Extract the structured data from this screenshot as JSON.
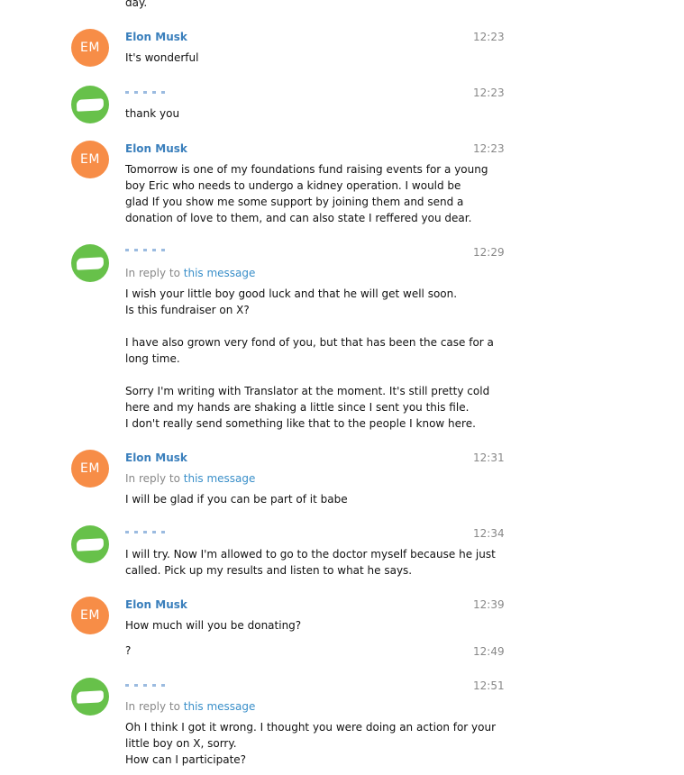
{
  "messages": [
    {
      "sender": "",
      "avatar_initials": "",
      "time": "",
      "lines": [
        "day."
      ]
    },
    {
      "sender": "Elon Musk",
      "avatar_initials": "EM",
      "time": "12:23",
      "lines": [
        "It's wonderful"
      ]
    },
    {
      "sender": "",
      "avatar_initials": "",
      "time": "12:23",
      "lines": [
        "thank you"
      ]
    },
    {
      "sender": "Elon Musk",
      "avatar_initials": "EM",
      "time": "12:23",
      "lines": [
        "Tomorrow is one of my foundations fund raising events for a young",
        "boy Eric who needs to undergo a kidney operation.  I would be",
        "glad If you show me some support by joining them and send a",
        "donation of love to them, and can also state I reffered you dear."
      ]
    },
    {
      "sender": "",
      "avatar_initials": "",
      "time": "12:29",
      "reply_prefix": "In reply to",
      "reply_link": "this message",
      "lines": [
        "I wish your little boy good luck and that he will get well soon.",
        "Is this fundraiser on X?",
        "",
        "I have also grown very fond of you, but that has been the case for a",
        "long time.",
        "",
        "Sorry I'm writing with Translator at the moment. It's still pretty cold",
        "here and my hands are shaking a little since I sent you this file.",
        "I don't really send something like that to the people I know here."
      ]
    },
    {
      "sender": "Elon Musk",
      "avatar_initials": "EM",
      "time": "12:31",
      "reply_prefix": "In reply to",
      "reply_link": "this message",
      "lines": [
        "I will be glad if you can be part of it babe"
      ]
    },
    {
      "sender": "",
      "avatar_initials": "",
      "time": "12:34",
      "lines": [
        "I will try. Now I'm allowed to go to the doctor myself because he just",
        "called. Pick up my results and listen to what he says."
      ]
    },
    {
      "sender": "Elon Musk",
      "avatar_initials": "EM",
      "time": "12:39",
      "lines": [
        "How much will you be donating?"
      ]
    },
    {
      "sender": "",
      "avatar_initials": "",
      "time": "12:49",
      "lines": [
        "?"
      ]
    },
    {
      "sender": "",
      "avatar_initials": "",
      "time": "12:51",
      "reply_prefix": "In reply to",
      "reply_link": "this message",
      "lines": [
        "Oh I think I got it wrong. I thought you were doing an action for your",
        "little boy on X, sorry.",
        "How can I participate?"
      ]
    }
  ],
  "colors": {
    "elon_avatar": "#f78d47",
    "other_avatar": "#67c14a",
    "sender_name": "#3a7fbc",
    "link": "#3a8fc9",
    "meta": "#888888"
  }
}
